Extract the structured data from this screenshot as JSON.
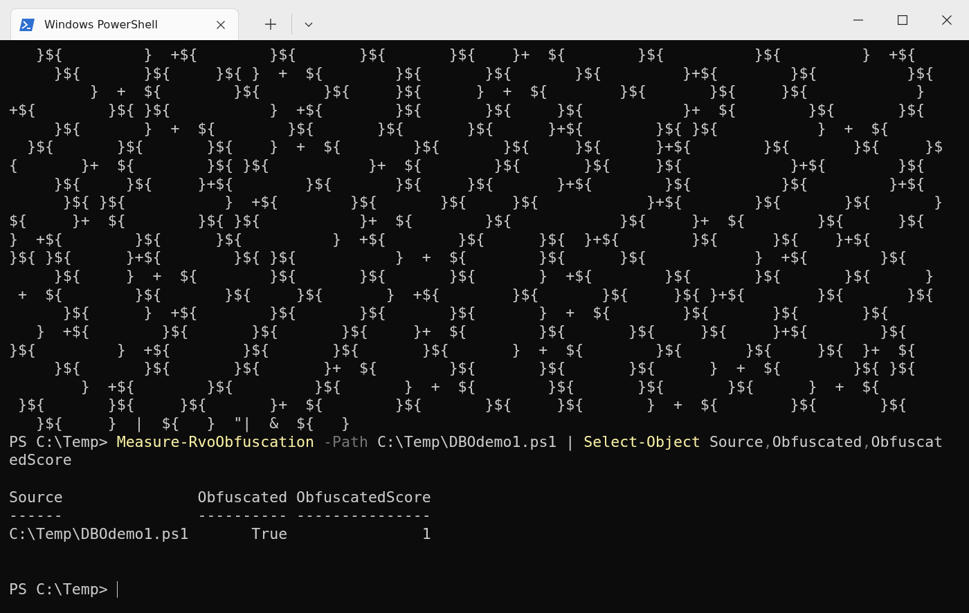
{
  "window": {
    "tabs": [
      {
        "title": "Windows PowerShell",
        "selected": true
      }
    ]
  },
  "terminal": {
    "obfuscated_lines": [
      "   }${         }  +${        }${       }${       }${    }+  ${        }${          }${         }  +${",
      "     }${       }${     }${ }  +  ${        }${       }${       }${         }+${        }${          }${",
      "         }  +  ${        }${       }${     }${      }  +  ${        }${       }${     }${            }",
      "+${        }${ }${           }  +${        }${       }${     }${           }+  ${        }${       }${",
      "     }${       }  +  ${        }${       }${       }${      }+${        }${ }${           }  +  ${",
      "  }${       }${       }${    }  +  ${        }${       }${     }${      }+${        }${       }${     }$",
      "{       }+  ${        }${ }${           }+  ${        }${       }${     }${            }+${        }${",
      "     }${     }${     }+${        }${       }${     }${       }+${        }${          }${         }+${",
      "      }${ }${           }  +${        }${       }${     }${            }+${        }${       }${       }",
      "${     }+  ${        }${ }${           }+  ${        }${            }${     }+  ${        }${      }${",
      "}  +${        }${      }${          }  +${        }${      }${  }+${        }${      }${    }+${",
      "}${ }${      }+${        }${ }${           }  +  ${        }${      }${            }  +${        }${",
      "     }${     }  +  ${        }${       }${       }${       }  +${        }${       }${       }${      }",
      " +  ${        }${       }${     }${       }  +${        }${       }${     }${ }+${        }${       }${",
      "      }${      }  +${        }${       }${       }${       }  +  ${        }${       }${       }${",
      "   }  +${        }${       }${       }${     }+  ${        }${       }${     }${     }+${        }${",
      "}${         }  +${        }${       }${       }${       }  +  ${        }${       }${     }${  }+  ${",
      "     }${       }${       }${       }+  ${        }${       }${       }${      }  +  ${        }${ }${",
      "        }  +${        }${         }${       }  +  ${        }${       }${       }${      }  +  ${",
      " }${       }${     }${       }+  ${        }${       }${     }${       }  +  ${        }${       }${",
      "   }${     }  |  ${   }  \"|  &  ${   }"
    ],
    "command_line": [
      {
        "kind": "text",
        "text": "PS C:\\Temp> "
      },
      {
        "kind": "command",
        "text": "Measure-RvoObfuscation"
      },
      {
        "kind": "parameter",
        "text": " -Path"
      },
      {
        "kind": "text",
        "text": " C:\\Temp\\DBOdemo1.ps1 | "
      },
      {
        "kind": "command",
        "text": "Select-Object"
      },
      {
        "kind": "text",
        "text": " Source"
      },
      {
        "kind": "separator",
        "text": ","
      },
      {
        "kind": "text",
        "text": "Obfuscated"
      },
      {
        "kind": "separator",
        "text": ","
      },
      {
        "kind": "text",
        "text": "ObfuscatedScore"
      }
    ],
    "output_lines": [
      "Source               Obfuscated ObfuscatedScore",
      "------               ---------- ---------------",
      "C:\\Temp\\DBOdemo1.ps1       True               1"
    ],
    "final_prompt": "PS C:\\Temp> "
  }
}
